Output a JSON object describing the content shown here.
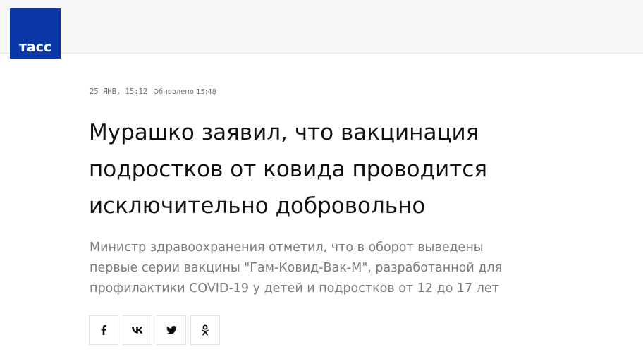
{
  "brand": {
    "logo_text": "тасс",
    "color": "#0b37a8"
  },
  "article": {
    "date": "25 ЯНВ, 15:12",
    "updated": "Обновлено 15:48",
    "headline_lines": [
      "Мурашко заявил, что вакцинация",
      "подростков от ковида проводится",
      "исключительно добровольно"
    ],
    "lead_lines": [
      "Министр здравоохранения отметил, что в оборот выведены",
      "первые серии вакцины \"Гам-Ковид-Вак-М\", разработанной для",
      "профилактики COVID-19 у детей и подростков от 12 до 17 лет"
    ]
  },
  "share": {
    "buttons": [
      {
        "icon": "facebook-icon"
      },
      {
        "icon": "vk-icon"
      },
      {
        "icon": "twitter-icon"
      },
      {
        "icon": "odnoklassniki-icon"
      }
    ]
  }
}
